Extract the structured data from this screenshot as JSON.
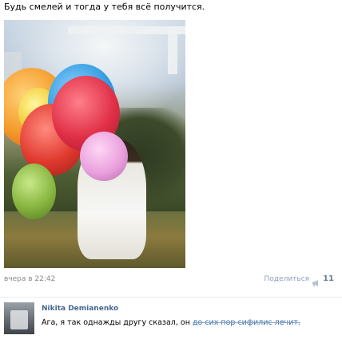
{
  "post": {
    "text": "Будь смелей и тогда у тебя всё получится.",
    "photo_icon": "photo-balloons-girl"
  },
  "meta": {
    "date": "вчера в 22:42",
    "share_label": "Поделиться",
    "share_icon": "megaphone-icon",
    "share_count": "11"
  },
  "comment": {
    "author": "Nikita Demianenko",
    "text_start": "Ага, я так однажды другу сказал, он ",
    "text_end": "до сих пор сифилис лечит."
  },
  "colors": {
    "link": "#45688e",
    "muted": "#8a8a8a",
    "share": "#8d9fb6"
  }
}
